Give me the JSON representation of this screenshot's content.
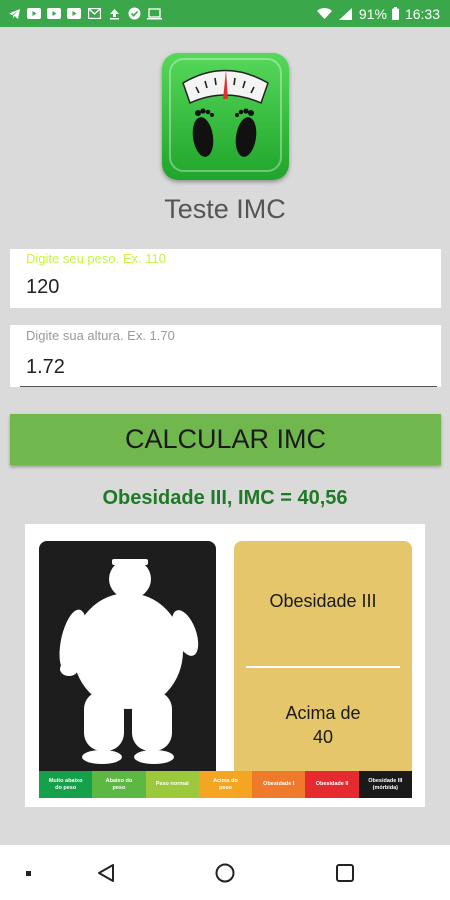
{
  "status_bar": {
    "battery": "91%",
    "time": "16:33"
  },
  "app": {
    "title": "Teste IMC"
  },
  "form": {
    "weight": {
      "label": "Digite seu peso. Ex. 110",
      "value": "120",
      "label_color": "#c6f542"
    },
    "height": {
      "label": "Digite sua altura. Ex. 1.70",
      "value": "1.72",
      "label_color": "#999999"
    }
  },
  "button": {
    "label": "CALCULAR IMC"
  },
  "result": {
    "text": "Obesidade III, IMC = 40,56"
  },
  "classification": {
    "name": "Obesidade III",
    "range_line1": "Acima de",
    "range_line2": "40"
  },
  "scale": [
    {
      "line1": "Muito abaixo",
      "line2": "do peso",
      "color": "#15a14a"
    },
    {
      "line1": "Abaixo do",
      "line2": "peso",
      "color": "#5cb842"
    },
    {
      "line1": "Peso normal",
      "line2": "",
      "color": "#9cc83c"
    },
    {
      "line1": "Acima do",
      "line2": "peso",
      "color": "#f4a622"
    },
    {
      "line1": "Obesidade I",
      "line2": "",
      "color": "#f07a2c"
    },
    {
      "line1": "Obesidade II",
      "line2": "",
      "color": "#e52b2f"
    },
    {
      "line1": "Obesidade III",
      "line2": "(mórbida)",
      "color": "#1a1a1a"
    }
  ]
}
